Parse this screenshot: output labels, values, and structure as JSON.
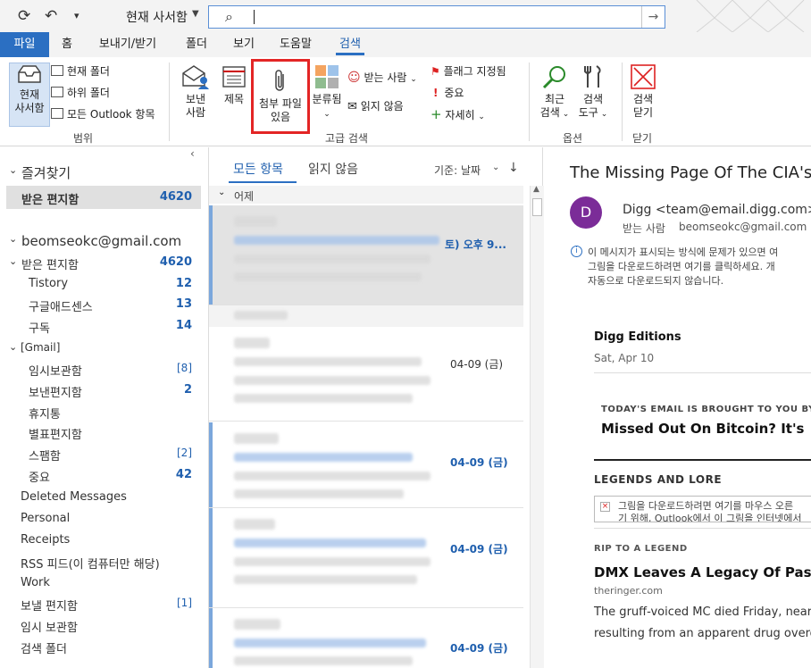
{
  "titlebar": {
    "search_scope": "현재 사서함",
    "search_value": ""
  },
  "tabs": [
    {
      "label": "파일"
    },
    {
      "label": "홈"
    },
    {
      "label": "보내기/받기"
    },
    {
      "label": "폴더"
    },
    {
      "label": "보기"
    },
    {
      "label": "도움말"
    },
    {
      "label": "검색"
    }
  ],
  "ribbon": {
    "current_mailbox": {
      "line1": "현재",
      "line2": "사서함"
    },
    "scope_items": [
      "현재 폴더",
      "하위 폴더",
      "모든 Outlook 항목"
    ],
    "scope_group": "범위",
    "from_btn": {
      "line1": "보낸",
      "line2": "사람"
    },
    "subject_btn": "제목",
    "attach_btn": {
      "line1": "첨부 파일",
      "line2": "있음"
    },
    "categorized_btn": "분류됨",
    "to_btn": "받는 사람",
    "unread_btn": "읽지 않음",
    "flagged_btn": "플래그 지정됨",
    "important_btn": "중요",
    "more_btn": "자세히",
    "refine_group": "고급 검색",
    "recent_btn": {
      "line1": "최근",
      "line2": "검색"
    },
    "tools_btn": {
      "line1": "검색",
      "line2": "도구"
    },
    "options_group": "옵션",
    "close_btn": {
      "line1": "검색",
      "line2": "닫기"
    },
    "close_group": "닫기"
  },
  "folders": {
    "favorites_header": "즐겨찾기",
    "fav_inbox": {
      "label": "받은 편지함",
      "count": "4620"
    },
    "account": "beomseokc@gmail.com",
    "items": [
      {
        "label": "받은 편지함",
        "count": "4620"
      },
      {
        "label": "Tistory",
        "count": "12"
      },
      {
        "label": "구글애드센스",
        "count": "13"
      },
      {
        "label": "구독",
        "count": "14"
      },
      {
        "label": "[Gmail]",
        "count": ""
      },
      {
        "label": "임시보관함",
        "count": "[8]"
      },
      {
        "label": "보낸편지함",
        "count": "2"
      },
      {
        "label": "휴지통",
        "count": ""
      },
      {
        "label": "별표편지함",
        "count": ""
      },
      {
        "label": "스팸함",
        "count": "[2]"
      },
      {
        "label": "중요",
        "count": "42"
      },
      {
        "label": "Deleted Messages",
        "count": ""
      },
      {
        "label": "Personal",
        "count": ""
      },
      {
        "label": "Receipts",
        "count": ""
      },
      {
        "label": "RSS 피드(이 컴퓨터만 해당)",
        "count": ""
      },
      {
        "label": "Work",
        "count": ""
      },
      {
        "label": "보낼 편지함",
        "count": "[1]"
      },
      {
        "label": "임시 보관함",
        "count": ""
      },
      {
        "label": "검색 폴더",
        "count": ""
      }
    ]
  },
  "message_list": {
    "tab_all": "모든 항목",
    "tab_unread": "읽지 않음",
    "sort_label": "기준: 날짜",
    "group_yesterday": "어제",
    "rows": [
      {
        "date": "토) 오후 9..."
      },
      {
        "date": "04-09 (금)"
      },
      {
        "date": "04-09 (금)"
      },
      {
        "date": "04-09 (금)"
      },
      {
        "date": "04-09 (금)"
      }
    ]
  },
  "reading": {
    "subject": "The Missing Page Of The CIA's",
    "avatar_letter": "D",
    "from": "Digg <team@email.digg.com>",
    "to_label": "받는 사람",
    "to_value": "beomseokc@gmail.com",
    "info_line1": "이 메시지가 표시되는 방식에 문제가 있으면 여",
    "info_line2": "그림을 다운로드하려면 여기를 클릭하세요. 개",
    "info_line3": "자동으로 다운로드되지 않습니다.",
    "edition_title": "Digg Editions",
    "edition_date": "Sat, Apr 10",
    "sponsor_label": "TODAY'S EMAIL IS BROUGHT TO YOU BY",
    "sponsor_headline": "Missed Out On Bitcoin? It's",
    "legends": "LEGENDS AND LORE",
    "img_line1": "그림을 다운로드하려면 여기를 마우스 오른",
    "img_line2": "기 위해, Outlook에서 이 그림을 인터넷에서",
    "rip_label": "RIP TO A LEGEND",
    "story_headline": "DMX Leaves A Legacy Of Passion",
    "story_source": "theringer.com",
    "story_body1": "The gruff-voiced MC died Friday, near",
    "story_body2": "resulting from an apparent drug overd"
  }
}
